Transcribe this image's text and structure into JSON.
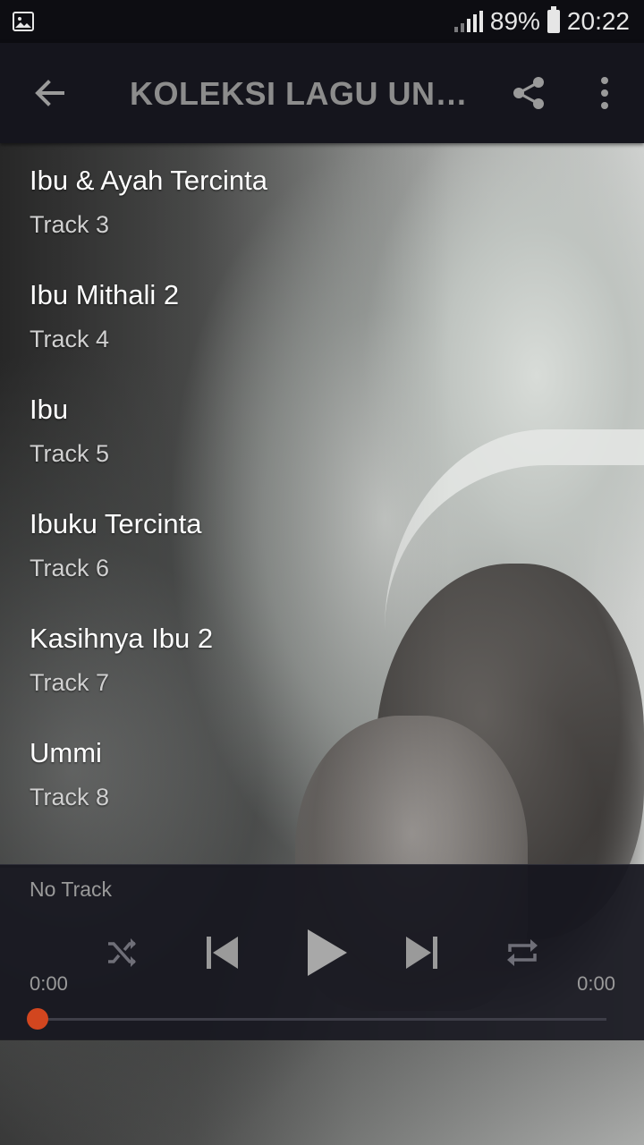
{
  "status_bar": {
    "battery_percent": "89%",
    "time": "20:22"
  },
  "toolbar": {
    "title": "KOLEKSI LAGU UNT..."
  },
  "tracks": [
    {
      "title": "Ibu & Ayah Tercinta",
      "subtitle": "Track 3"
    },
    {
      "title": "Ibu Mithali 2",
      "subtitle": "Track 4"
    },
    {
      "title": "Ibu",
      "subtitle": "Track 5"
    },
    {
      "title": "Ibuku Tercinta",
      "subtitle": "Track 6"
    },
    {
      "title": "Kasihnya Ibu 2",
      "subtitle": "Track 7"
    },
    {
      "title": "Ummi",
      "subtitle": "Track 8"
    }
  ],
  "player": {
    "now_playing": "No Track",
    "elapsed": "0:00",
    "duration": "0:00",
    "progress": 0,
    "accent_color": "#d2461f"
  },
  "icons": {
    "status": [
      "image-icon",
      "signal-icon",
      "battery-icon"
    ],
    "toolbar": [
      "back-arrow-icon",
      "share-icon",
      "more-vert-icon"
    ],
    "player": [
      "shuffle-icon",
      "skip-previous-icon",
      "play-icon",
      "skip-next-icon",
      "repeat-icon"
    ]
  }
}
